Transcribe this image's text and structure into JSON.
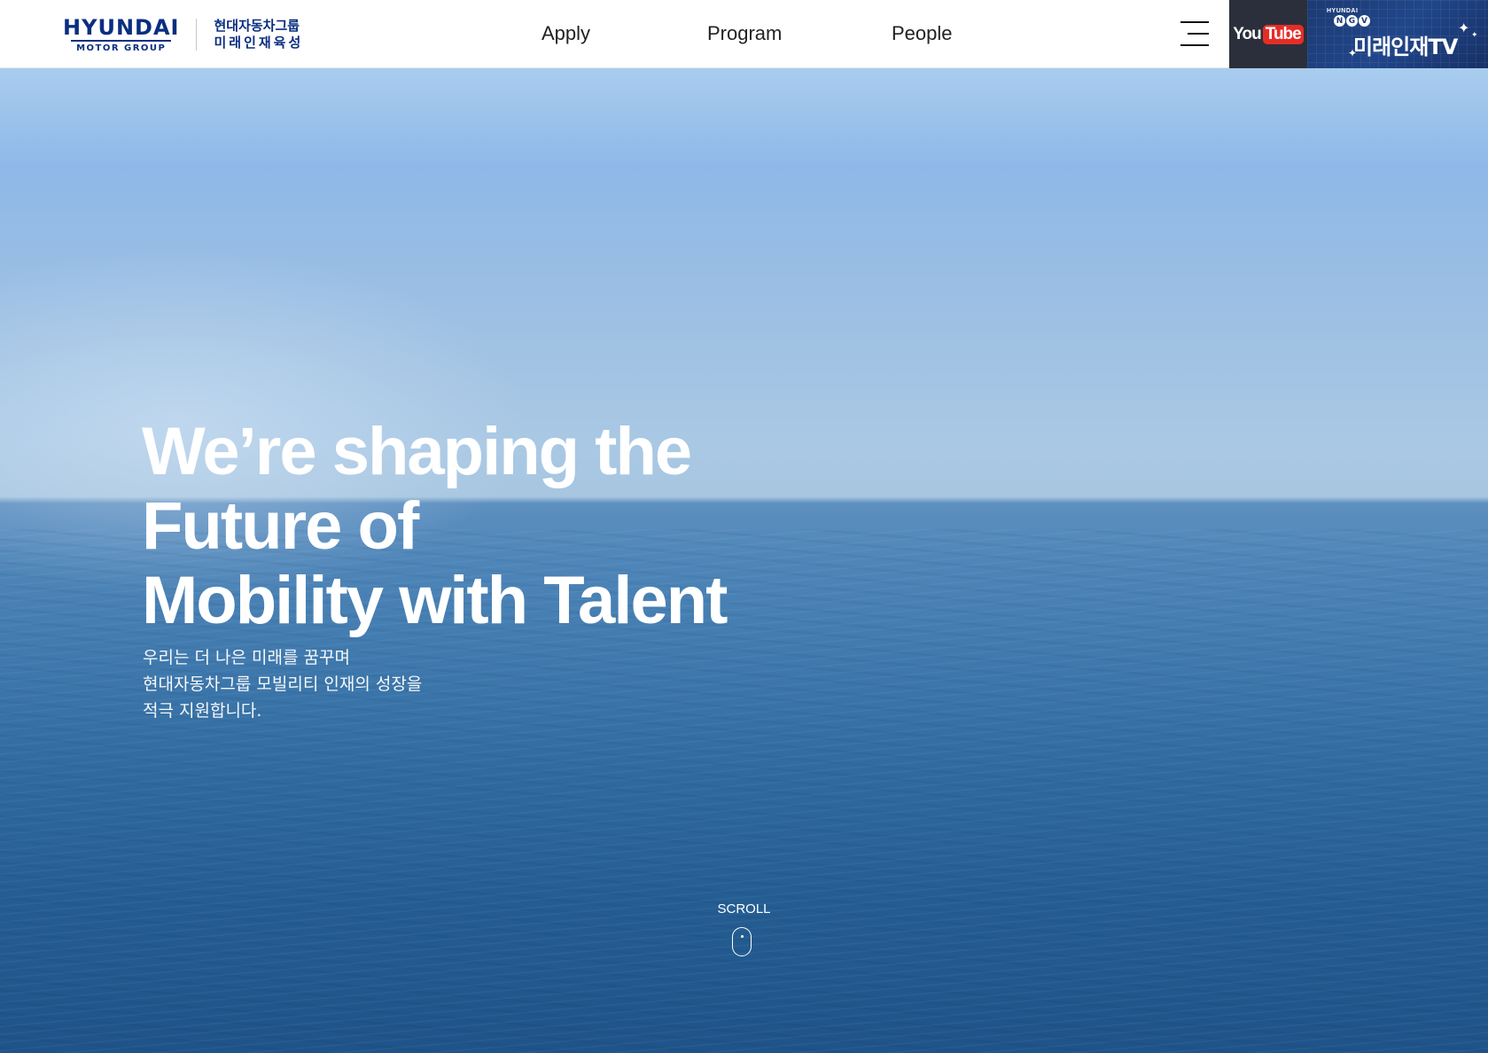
{
  "header": {
    "logo": {
      "wordmark": "HYUNDAI",
      "sub": "MOTOR GROUP",
      "kr_line1": "현대자동차그룹",
      "kr_line2": "미래인재육성"
    },
    "nav": [
      {
        "label": "Apply"
      },
      {
        "label": "Program"
      },
      {
        "label": "People"
      }
    ],
    "menu_icon": "hamburger-icon",
    "youtube": {
      "you": "You",
      "tube": "Tube"
    },
    "ngv": {
      "small": "HYUNDAI",
      "badge": [
        "N",
        "G",
        "V"
      ],
      "title": "미래인재TV"
    }
  },
  "hero": {
    "headline": [
      "We’re shaping the",
      "Future of",
      "Mobility with Talent"
    ],
    "subtext": [
      "우리는 더 나은 미래를 꿈꾸며",
      "현대자동차그룹 모빌리티 인재의 성장을",
      "적극 지원합니다."
    ],
    "scroll_label": "SCROLL",
    "scroll_icon": "mouse-icon"
  },
  "colors": {
    "brand_navy": "#0a2e80",
    "youtube_red": "#e52d27",
    "youtube_bg": "#2b2f3b",
    "ngv_bg": "#1c3a73"
  }
}
